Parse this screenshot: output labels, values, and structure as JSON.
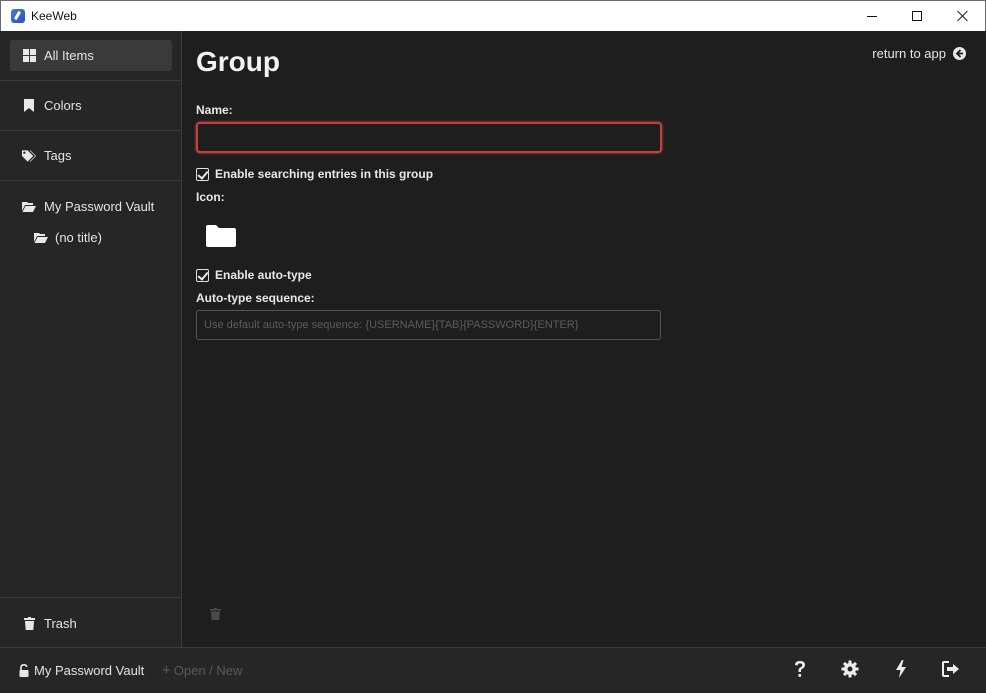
{
  "window": {
    "title": "KeeWeb",
    "icon": "keeweb-logo-icon"
  },
  "sidebar": {
    "items": [
      {
        "label": "All Items",
        "icon": "grid-icon",
        "active": true
      },
      {
        "label": "Colors",
        "icon": "bookmark-icon"
      },
      {
        "label": "Tags",
        "icon": "tags-icon"
      },
      {
        "label": "My Password Vault",
        "icon": "folder-open-icon"
      }
    ],
    "sub_items": [
      {
        "label": "(no title)",
        "icon": "folder-open-icon"
      }
    ],
    "trash": {
      "label": "Trash",
      "icon": "trash-icon"
    }
  },
  "main": {
    "title": "Group",
    "return_link": "return to app",
    "name_label": "Name:",
    "name_value": "",
    "enable_search_label": "Enable searching entries in this group",
    "enable_search_checked": true,
    "icon_label": "Icon:",
    "group_icon": "folder-icon",
    "enable_autotype_label": "Enable auto-type",
    "enable_autotype_checked": true,
    "autotype_label": "Auto-type sequence:",
    "autotype_placeholder": "Use default auto-type sequence: {USERNAME}{TAB}{PASSWORD}{ENTER}",
    "autotype_value": ""
  },
  "footer": {
    "vault_name": "My Password Vault",
    "open_new_label": "Open / New",
    "buttons": [
      "help-icon",
      "settings-icon",
      "lightning-icon",
      "sign-out-icon"
    ]
  },
  "colors": {
    "background": "#1e1e1e",
    "sidebar": "#262626",
    "error_border": "#c0403a"
  }
}
